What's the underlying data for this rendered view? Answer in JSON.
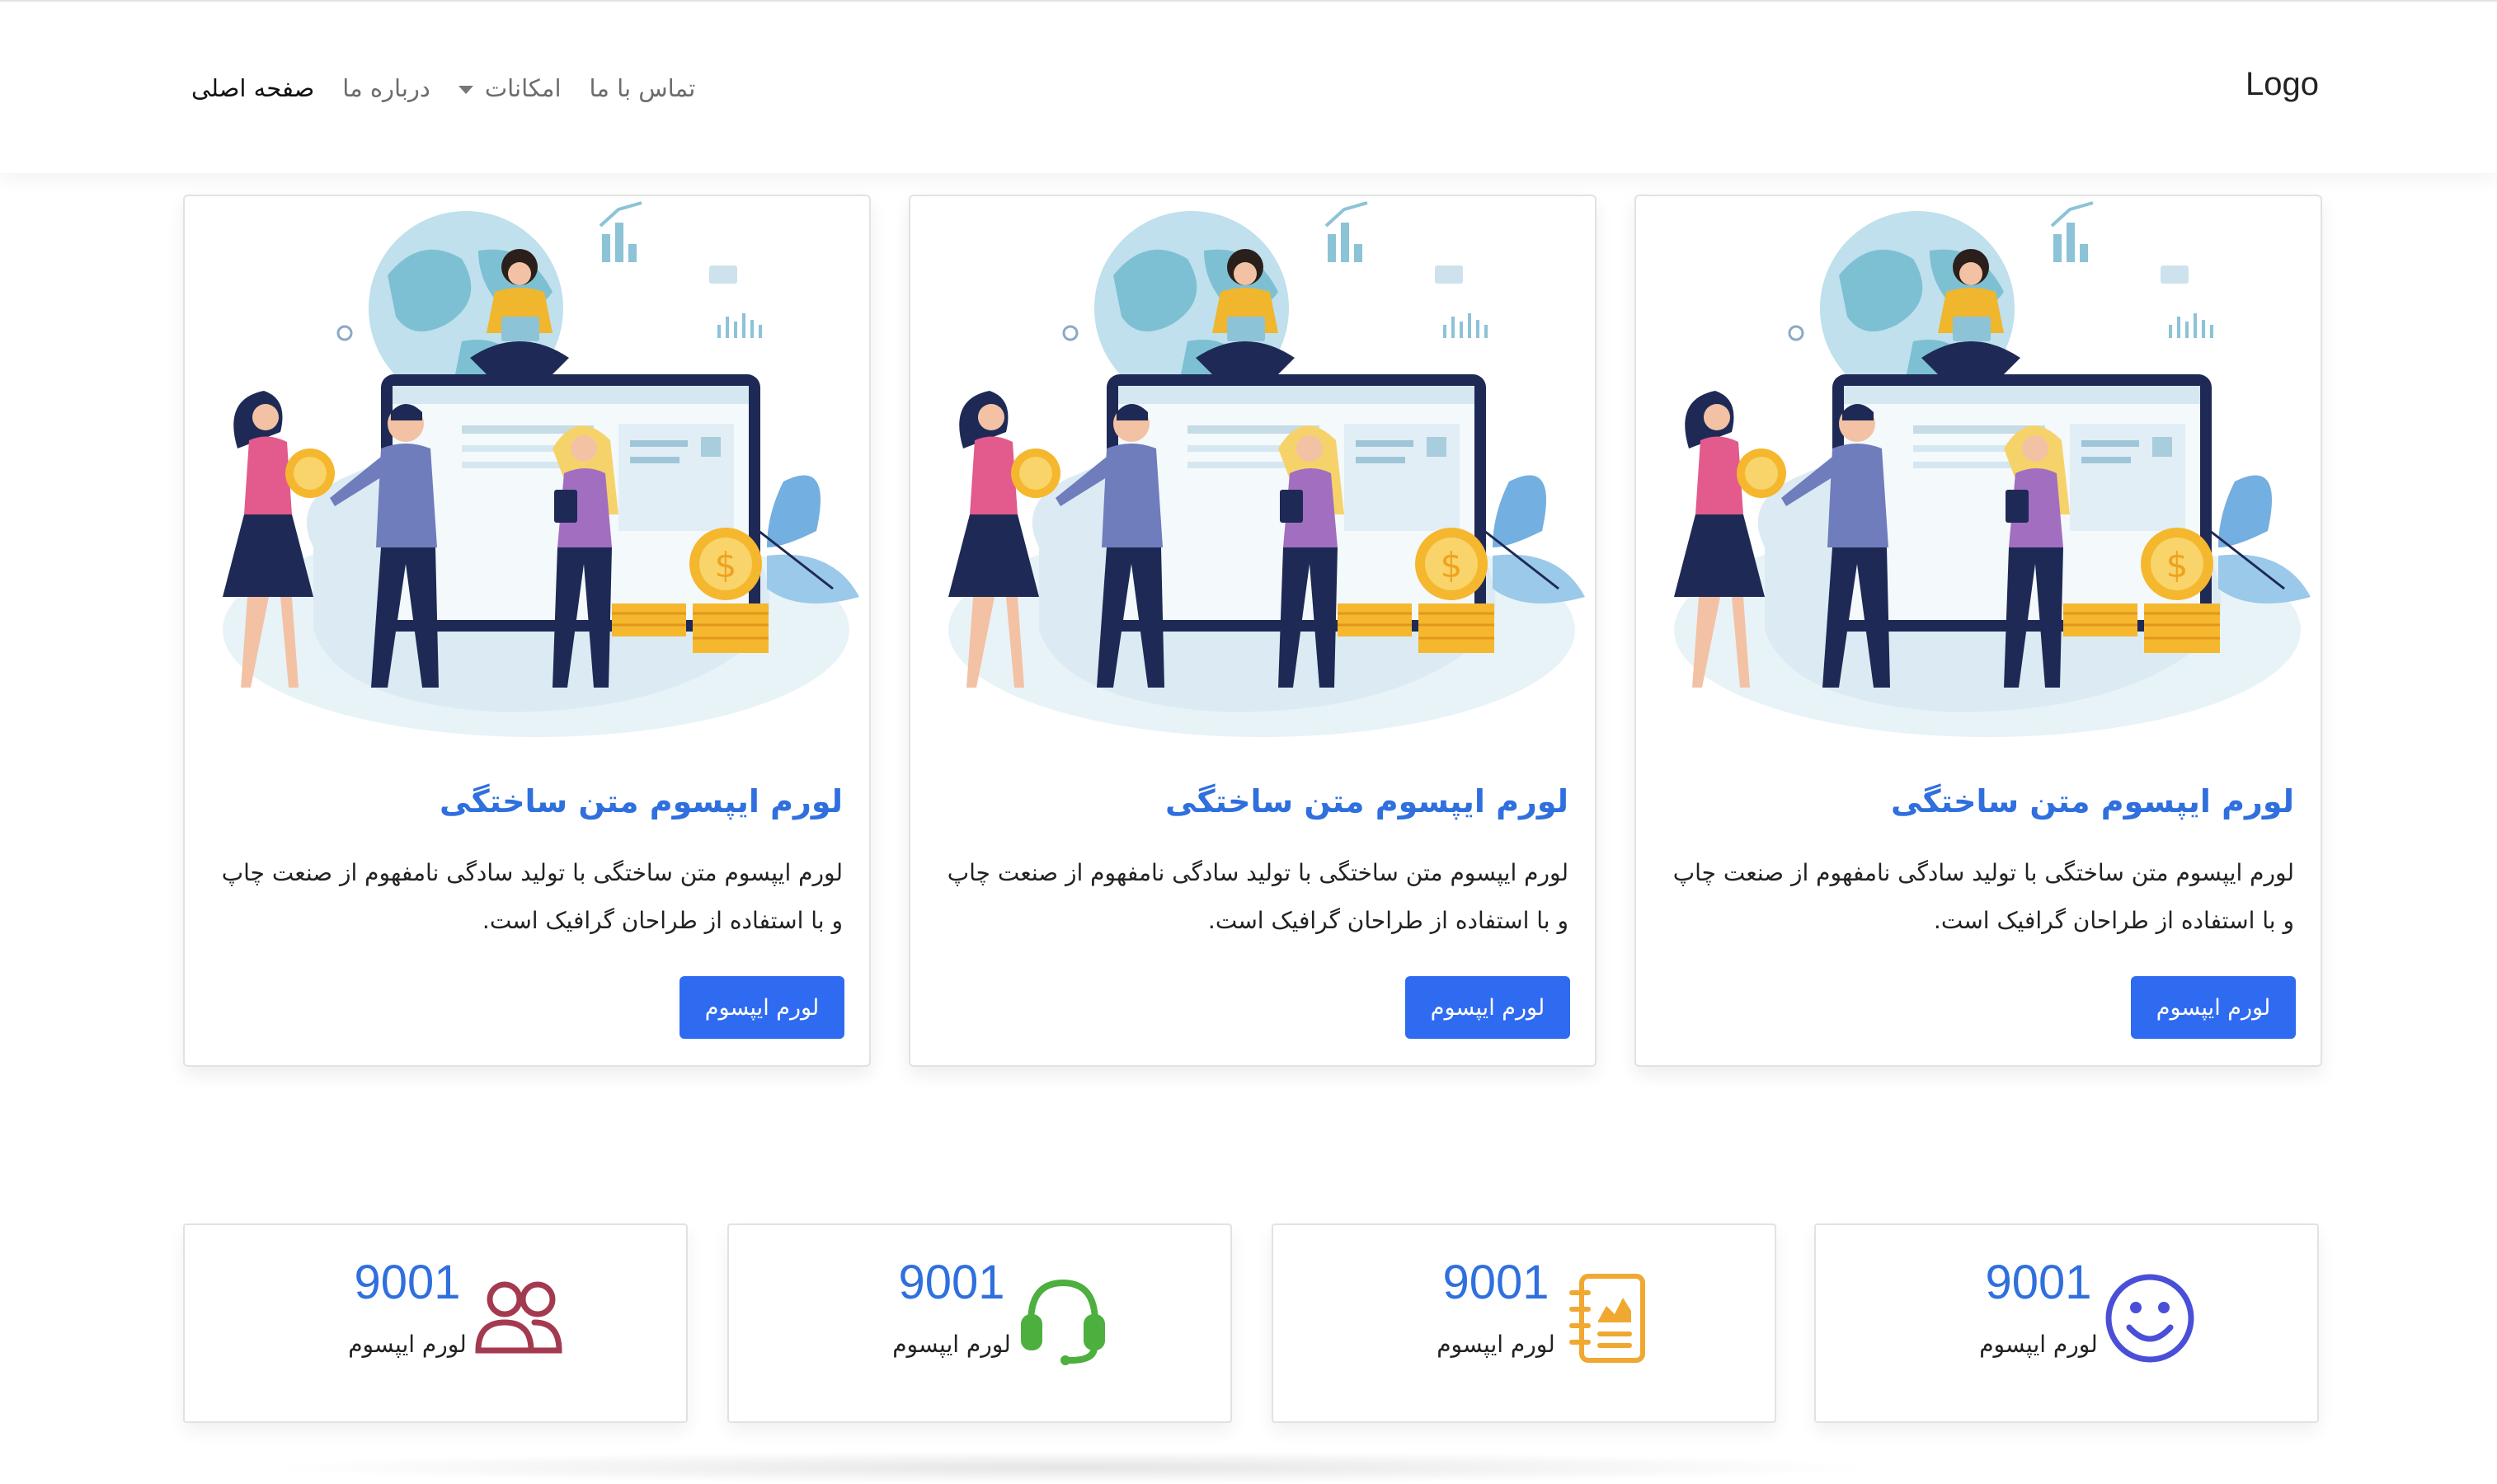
{
  "header": {
    "logo": "Logo",
    "nav": [
      {
        "label": "صفحه اصلی",
        "active": true
      },
      {
        "label": "درباره ما",
        "active": false
      },
      {
        "label": "امکانات",
        "active": false,
        "dropdown": true
      },
      {
        "label": "تماس با ما",
        "active": false
      }
    ]
  },
  "cards": [
    {
      "title": "لورم ایپسوم متن ساختگی",
      "text": "لورم ایپسوم متن ساختگی با تولید سادگی نامفهوم از صنعت چاپ و با استفاده از طراحان گرافیک است.",
      "button": "لورم ایپسوم"
    },
    {
      "title": "لورم ایپسوم متن ساختگی",
      "text": "لورم ایپسوم متن ساختگی با تولید سادگی نامفهوم از صنعت چاپ و با استفاده از طراحان گرافیک است.",
      "button": "لورم ایپسوم"
    },
    {
      "title": "لورم ایپسوم متن ساختگی",
      "text": "لورم ایپسوم متن ساختگی با تولید سادگی نامفهوم از صنعت چاپ و با استفاده از طراحان گرافیک است.",
      "button": "لورم ایپسوم"
    }
  ],
  "stats": [
    {
      "value": "9001",
      "label": "لورم ایپسوم",
      "icon": "users-icon",
      "color": "#a33a4f"
    },
    {
      "value": "9001",
      "label": "لورم ایپسوم",
      "icon": "headset-icon",
      "color": "#4caf3e"
    },
    {
      "value": "9001",
      "label": "لورم ایپسوم",
      "icon": "notebook-chart-icon",
      "color": "#f0a830"
    },
    {
      "value": "9001",
      "label": "لورم ایپسوم",
      "icon": "smiley-icon",
      "color": "#4a4fd8"
    }
  ],
  "colors": {
    "accent": "#2f6fde",
    "button": "#2f6bf1"
  }
}
